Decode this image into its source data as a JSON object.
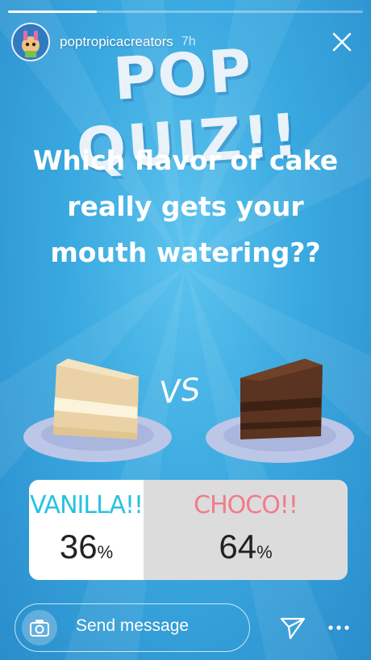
{
  "story": {
    "progress_fraction": 0.25,
    "username": "poptropicacreators",
    "time_ago": "7h"
  },
  "content": {
    "title": "POP QUIZ!!",
    "question_lines": [
      "Which flavor of cake",
      "really gets your",
      "mouth watering??"
    ],
    "vs": "VS"
  },
  "poll": {
    "options": [
      {
        "label": "VANILLA!!",
        "percent": "36",
        "unit": "%"
      },
      {
        "label": "CHOCO!!",
        "percent": "64",
        "unit": "%"
      }
    ]
  },
  "footer": {
    "placeholder": "Send message"
  },
  "colors": {
    "vanilla": "#27c2e0",
    "choco": "#f27a8a",
    "background": "#3aa9e0"
  },
  "icons": [
    "camera-icon",
    "send-icon",
    "more-icon",
    "close-icon"
  ]
}
